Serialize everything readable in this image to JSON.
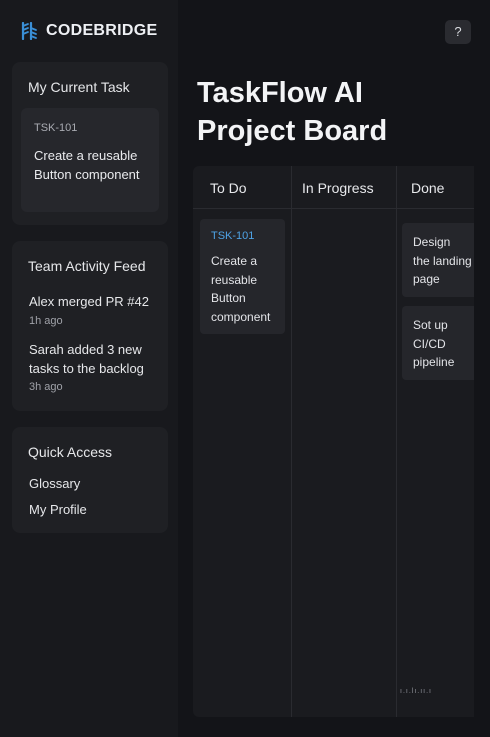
{
  "brand": {
    "name": "CODEBRIDGE",
    "accent": "#3a8fd6",
    "logo_icon": "codebridge-logo-icon"
  },
  "header": {
    "help_label": "?",
    "help_icon": "help-icon"
  },
  "page": {
    "title_line1": "TaskFlow AI",
    "title_line2": "Project Board"
  },
  "current_task": {
    "title": "My Current Task",
    "task_id": "TSK-101",
    "task_text": "Create a reusable Button component"
  },
  "activity_feed": {
    "title": "Team Activity Feed",
    "items": [
      {
        "text": "Alex merged PR #42",
        "time": "1h ago"
      },
      {
        "text": "Sarah added 3 new tasks to the backlog",
        "time": "3h ago"
      }
    ]
  },
  "quick_access": {
    "title": "Quick Access",
    "links": [
      "Glossary",
      "My Profile"
    ]
  },
  "board": {
    "columns": [
      {
        "name": "To Do",
        "cards": [
          {
            "id": "TSK-101",
            "lines": [
              "Create a",
              "reusable",
              "Button",
              "component"
            ]
          }
        ]
      },
      {
        "name": "In Progress",
        "cards": []
      },
      {
        "name": "Done",
        "cards": [
          {
            "lines": [
              "Design",
              "the landing",
              "page"
            ]
          },
          {
            "lines": [
              "Sot up",
              "CI/CD",
              "pipeline"
            ]
          }
        ]
      }
    ]
  },
  "watermark": "ı.ı.lı.ıı.ı"
}
